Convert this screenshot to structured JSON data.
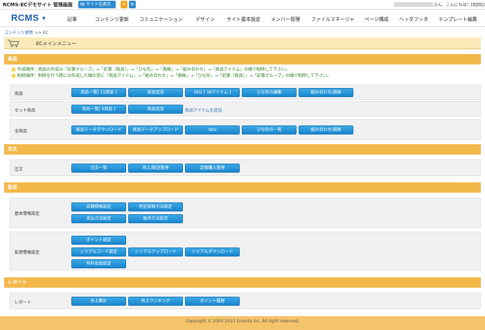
{
  "topbar": {
    "site_title": "RCMS-ECデモサイト 管理画面",
    "view_site": "サイトを表示",
    "greeting": "さん、こんにちは！[前回ロ"
  },
  "nav": {
    "logo": "RCMS",
    "items": [
      "記事",
      "コンテンツ更新",
      "コミュニケーション",
      "デザイン",
      "サイト基本設定",
      "メンバー管理",
      "ファイルマネージャ",
      "ページ構成",
      "ヘッダフッタ",
      "テンプレート編集"
    ]
  },
  "breadcrumb": {
    "parent": "コンテンツ更新",
    "sep": ">>",
    "current": "EC"
  },
  "page_title": "ECメインメニュー",
  "sections": {
    "product": {
      "title": "商品",
      "notes": [
        "作成順序：商品の作成は「記事グループ」→「記事（商品）」→「ひな形」→「規格」→「組み合わせ」→「商品アイテム」の順で削除して下さい。",
        "削除順序：削除を行う際には作成した順の逆に「商品アイテム」→「組み合わせ」→「規格」→「ひな形」→「記事（商品）」→「記事グループ」の順で削除して下さい。"
      ],
      "rows": [
        {
          "label": "商品",
          "buttons": [
            "商品一覧[ 15商品 ]",
            "商品追加",
            "SKU [ 38アイテム ]",
            "ひな形の編集",
            "組み合わせ/規格"
          ]
        },
        {
          "label": "セット商品",
          "buttons": [
            "商品一覧[ 0商品 ]",
            "商品追加"
          ],
          "link": "商品アイテムを追加"
        },
        {
          "label": "全商品",
          "buttons": [
            "商品データダウンロード",
            "商品データアップロード",
            "SKU",
            "ひな形の一覧",
            "組み合わせ/規格"
          ]
        }
      ]
    },
    "order": {
      "title": "注文",
      "rows": [
        {
          "label": "注文",
          "buttons": [
            "注文一覧",
            "売上/配送管理",
            "定期購入管理"
          ]
        }
      ]
    },
    "settings": {
      "title": "設定",
      "rows": [
        {
          "label": "基本情報設定",
          "buttons": [
            "店舗情報設定",
            "特定商取引法設定",
            "支払方法設定",
            "販売方法設定"
          ]
        },
        {
          "label": "拡張情報設定",
          "buttons": [
            "ポイント設定",
            "シリアルコード設定",
            "シリアルアップロード",
            "シリアルダウンロード",
            "有料会員設定"
          ]
        }
      ]
    },
    "report": {
      "title": "レポート",
      "rows": [
        {
          "label": "レポート",
          "buttons": [
            "売上集計",
            "売上ランキング",
            "ポイント履歴"
          ]
        }
      ]
    }
  },
  "footer": "Copyright © 2005-2015 Diverta inc. All right reserved."
}
